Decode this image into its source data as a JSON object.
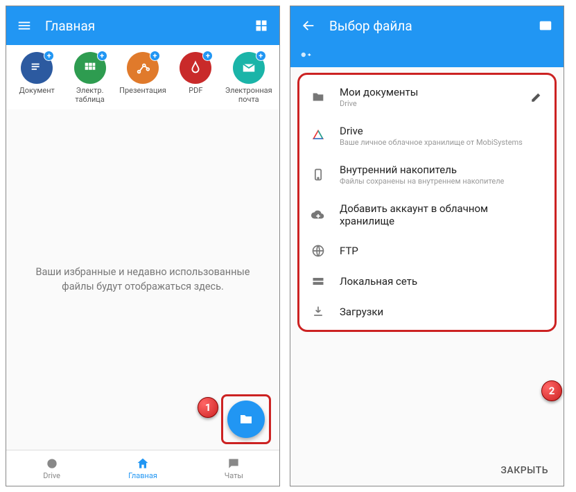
{
  "left": {
    "title": "Главная",
    "docs": [
      {
        "label": "Документ",
        "color": "#2c5aa0"
      },
      {
        "label": "Электр. таблица",
        "color": "#2e9c50"
      },
      {
        "label": "Презентация",
        "color": "#e07a2b"
      },
      {
        "label": "PDF",
        "color": "#c92a2a"
      },
      {
        "label": "Электронная почта",
        "color": "#1ab4a8"
      }
    ],
    "empty_text": "Ваши избранные и недавно использованные файлы будут отображаться здесь.",
    "nav": [
      {
        "label": "Drive"
      },
      {
        "label": "Главная"
      },
      {
        "label": "Чаты"
      }
    ],
    "badge": "1"
  },
  "right": {
    "title": "Выбор файла",
    "items": [
      {
        "title": "Мои документы",
        "sub": "Drive",
        "editable": true,
        "icon": "folder"
      },
      {
        "title": "Drive",
        "sub": "Ваше личное облачное хранилище от MobiSystems",
        "icon": "drive"
      },
      {
        "title": "Внутренний накопитель",
        "sub": "Файлы сохранены на внутреннем накопителе",
        "icon": "phone"
      },
      {
        "title": "Добавить аккаунт в облачном хранилище",
        "icon": "cloudplus"
      },
      {
        "title": "FTP",
        "icon": "globe"
      },
      {
        "title": "Локальная сеть",
        "icon": "lan"
      },
      {
        "title": "Загрузки",
        "icon": "download"
      }
    ],
    "close": "ЗАКРЫТЬ",
    "badge": "2"
  }
}
